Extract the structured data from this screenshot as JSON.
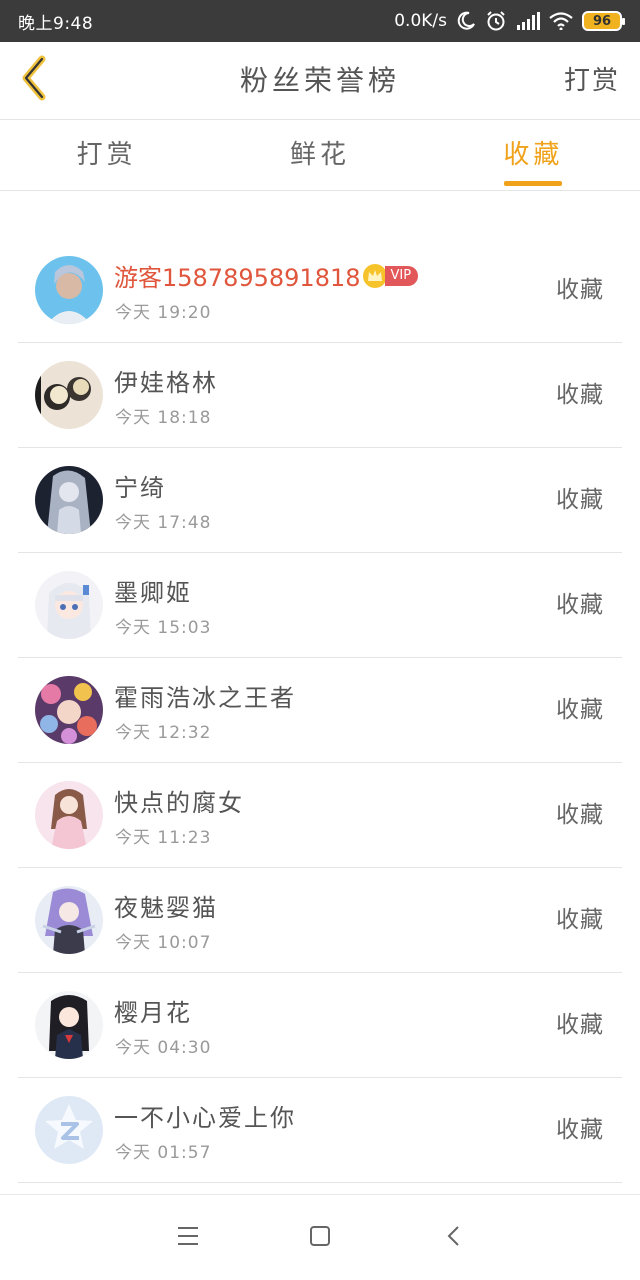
{
  "status_bar": {
    "time": "晚上9:48",
    "net_speed": "0.0K/s",
    "battery": "96",
    "icons": [
      "moon-icon",
      "alarm-icon",
      "signal-icon",
      "wifi-icon",
      "battery-icon"
    ]
  },
  "header": {
    "title": "粉丝荣誉榜",
    "action": "打赏"
  },
  "tabs": [
    {
      "label": "打赏",
      "active": false
    },
    {
      "label": "鲜花",
      "active": false
    },
    {
      "label": "收藏",
      "active": true
    }
  ],
  "list": [
    {
      "name": "游客15878958918​18",
      "time": "今天 19:20",
      "action": "收藏",
      "vip": true,
      "vip_label": "VIP"
    },
    {
      "name": "伊娃格林",
      "time": "今天 18:18",
      "action": "收藏"
    },
    {
      "name": "宁绮",
      "time": "今天 17:48",
      "action": "收藏"
    },
    {
      "name": "墨卿姬",
      "time": "今天 15:03",
      "action": "收藏"
    },
    {
      "name": "霍雨浩冰之王者",
      "time": "今天 12:32",
      "action": "收藏"
    },
    {
      "name": "快点的腐女",
      "time": "今天 11:23",
      "action": "收藏"
    },
    {
      "name": "夜魅婴猫",
      "time": "今天 10:07",
      "action": "收藏"
    },
    {
      "name": "樱月花",
      "time": "今天 04:30",
      "action": "收藏"
    },
    {
      "name": "一不小心爱上你",
      "time": "今天 01:57",
      "action": "收藏"
    }
  ],
  "colors": {
    "accent": "#f0a21a",
    "vip_name": "#e0563c",
    "vip_badge": "#e2575a",
    "status_bar": "#3b3b3b"
  }
}
